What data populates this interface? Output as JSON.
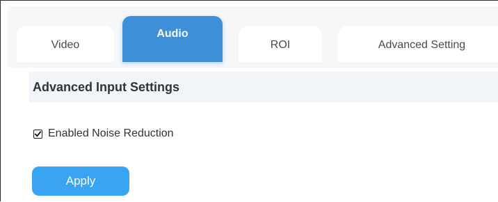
{
  "tabs": [
    {
      "label": "Video",
      "active": false
    },
    {
      "label": "Audio",
      "active": true
    },
    {
      "label": "ROI",
      "active": false
    },
    {
      "label": "Advanced Setting",
      "active": false
    }
  ],
  "section": {
    "title": "Advanced Input Settings"
  },
  "noise_reduction": {
    "label": "Enabled Noise Reduction",
    "checked": true
  },
  "apply_button": {
    "label": "Apply"
  },
  "colors": {
    "active_tab": "#3d8fd8",
    "apply_button": "#39a4f2",
    "section_header_bg": "#f1f5fa",
    "tabbar_bg": "#f5f7f8"
  }
}
